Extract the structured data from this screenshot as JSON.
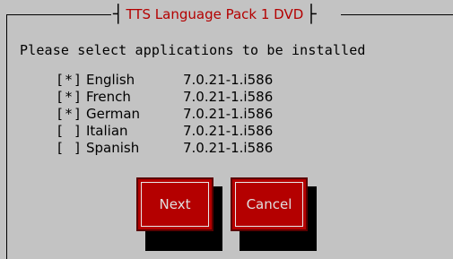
{
  "dialog": {
    "title": "TTS Language Pack 1 DVD",
    "prompt": "Please select applications to be installed"
  },
  "applications": [
    {
      "checkbox": "[*]",
      "name": "English",
      "version": "7.0.21-1.i586"
    },
    {
      "checkbox": "[*]",
      "name": "French",
      "version": "7.0.21-1.i586"
    },
    {
      "checkbox": "[*]",
      "name": "German",
      "version": "7.0.21-1.i586"
    },
    {
      "checkbox": "[ ]",
      "name": "Italian",
      "version": "7.0.21-1.i586"
    },
    {
      "checkbox": "[ ]",
      "name": "Spanish",
      "version": "7.0.21-1.i586"
    }
  ],
  "buttons": {
    "next_label": "Next",
    "cancel_label": "Cancel"
  },
  "colors": {
    "background": "#c3c3c3",
    "accent": "#b40000",
    "shadow": "#000000"
  }
}
